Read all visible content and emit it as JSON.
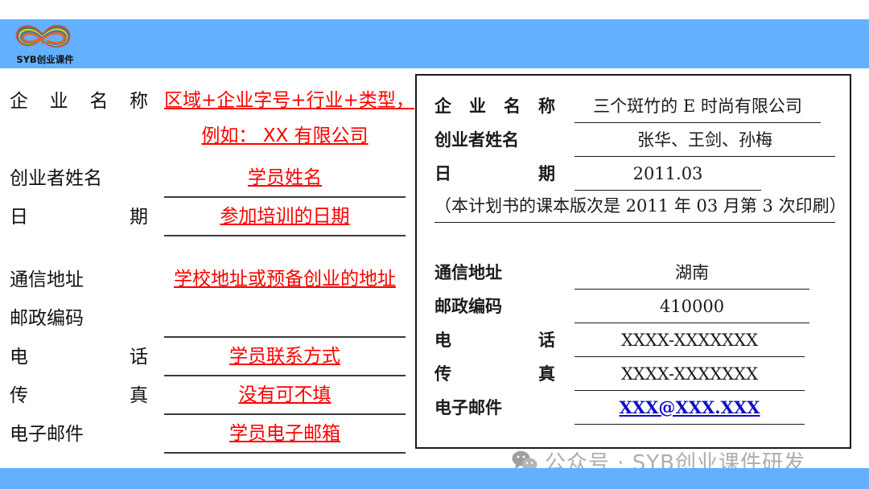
{
  "banner": {
    "logo_caption": "SYB创业课件",
    "logo_icon": "rainbow-infinity-logo",
    "accent_color": "#63b1fe"
  },
  "left_form": {
    "title_note": "template-with-red-instructions",
    "red_color": "#ff0000",
    "rows": [
      {
        "label": "企业名称",
        "label_chars": [
          "企",
          "业",
          "名",
          "称"
        ],
        "value_line1": "区域+企业字号+行业+类型，",
        "value_line2": "例如： XX 有限公司"
      },
      {
        "label": "创业者姓名",
        "label_chars": [
          "创业者姓名"
        ],
        "value": "学员姓名"
      },
      {
        "label": "日期",
        "label_chars": [
          "日",
          "期"
        ],
        "value": "参加培训的日期"
      },
      {
        "label": "通信地址",
        "label_chars": [
          "通信地址"
        ],
        "value": "学校地址或预备创业的地址"
      },
      {
        "label": "邮政编码",
        "label_chars": [
          "邮政编码"
        ],
        "value": ""
      },
      {
        "label": "电话",
        "label_chars": [
          "电",
          "话"
        ],
        "value": "学员联系方式"
      },
      {
        "label": "传真",
        "label_chars": [
          "传",
          "真"
        ],
        "value": "没有可不填"
      },
      {
        "label": "电子邮件",
        "label_chars": [
          "电子邮件"
        ],
        "value": "学员电子邮箱"
      }
    ]
  },
  "right_panel": {
    "link_color": "#0d0dc8",
    "rows": [
      {
        "label_chars": [
          "企",
          "业",
          "名",
          "称"
        ],
        "value": "三个斑竹的 E 时尚有限公司"
      },
      {
        "label_chars": [
          "创业者姓名"
        ],
        "value": "张华、王剑、孙梅"
      },
      {
        "label_chars": [
          "日",
          "期"
        ],
        "value": "2011.03"
      }
    ],
    "note": "（本计划书的课本版次是 2011 年 03 月第 3 次印刷）",
    "rows2": [
      {
        "label_chars": [
          "通信地址"
        ],
        "value": "湖南"
      },
      {
        "label_chars": [
          "邮政编码"
        ],
        "value": "410000"
      },
      {
        "label_chars": [
          "电",
          "话"
        ],
        "value": "XXXX-XXXXXXX"
      },
      {
        "label_chars": [
          "传",
          "真"
        ],
        "value": "XXXX-XXXXXXX"
      },
      {
        "label_chars": [
          "电子邮件"
        ],
        "value": "XXX@XXX.XXX",
        "is_link": true
      }
    ]
  },
  "watermark": {
    "icon": "wechat-icon",
    "text": "公众号 · SYB创业课件研发"
  }
}
